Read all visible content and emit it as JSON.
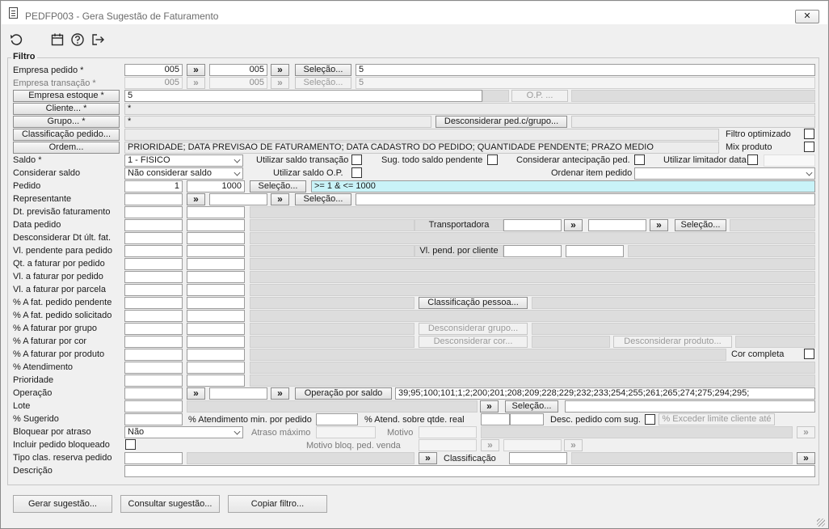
{
  "window": {
    "title": "PEDFP003 - Gera Sugestão de Faturamento",
    "close_glyph": "✕"
  },
  "toolbar": {
    "icons": [
      "refresh-icon",
      "calendar-icon",
      "help-icon",
      "exit-icon"
    ]
  },
  "group_title": "Filtro",
  "labels": {
    "empresa_pedido": "Empresa pedido *",
    "empresa_transacao": "Empresa transação *",
    "saldo": "Saldo *",
    "considerar_saldo": "Considerar saldo",
    "pedido": "Pedido",
    "representante": "Representante",
    "dt_previsao": "Dt. previsão faturamento",
    "data_pedido": "Data pedido",
    "desconsiderar_dt": "Desconsiderar Dt últ. fat.",
    "vl_pendente": "Vl. pendente para pedido",
    "qt_faturar_pedido": "Qt. a faturar por pedido",
    "vl_faturar_pedido": "Vl. a faturar por pedido",
    "vl_faturar_parcela": "Vl. a faturar por parcela",
    "pct_fat_pendente": "% A fat. pedido pendente",
    "pct_fat_solicitado": "% A fat. pedido solicitado",
    "pct_faturar_grupo": "% A faturar por grupo",
    "pct_faturar_cor": "% A faturar por cor",
    "pct_faturar_produto": "% A faturar por produto",
    "pct_atendimento": "% Atendimento",
    "prioridade": "Prioridade",
    "operacao": "Operação",
    "lote": "Lote",
    "pct_sugerido": "% Sugerido",
    "bloquear_atraso": "Bloquear por atraso",
    "incluir_bloqueado": "Incluir pedido bloqueado",
    "tipo_clas_reserva": "Tipo clas. reserva pedido",
    "descricao": "Descrição",
    "filtro_optimizado": "Filtro optimizado",
    "mix_produto": "Mix produto",
    "utilizar_saldo_transacao": "Utilizar saldo transação",
    "sug_todo_saldo": "Sug. todo saldo pendente",
    "considerar_antecipacao": "Considerar antecipação ped.",
    "utilizar_limitador": "Utilizar limitador data",
    "utilizar_saldo_op": "Utilizar saldo O.P.",
    "ordenar_item": "Ordenar item pedido",
    "transportadora": "Transportadora",
    "vl_pend_cliente": "Vl. pend. por cliente",
    "cor_completa": "Cor completa",
    "pct_atend_min": "% Atendimento min. por pedido",
    "pct_atend_qtde": "% Atend. sobre qtde. real",
    "desc_pedido_sug": "Desc. pedido com sug.",
    "atraso_maximo": "Atraso máximo",
    "motivo": "Motivo",
    "motivo_bloq": "Motivo bloq. ped. venda",
    "classificacao": "Classificação"
  },
  "buttons": {
    "selecao": "Seleção...",
    "arrow": "»",
    "empresa_estoque": "Empresa estoque *",
    "op": "O.P. ...",
    "cliente": "Cliente... *",
    "grupo": "Grupo... *",
    "desconsiderar_ped_grupo": "Desconsiderar ped.c/grupo...",
    "classificacao_pedido": "Classificação pedido...",
    "ordem": "Ordem...",
    "classificacao_pessoa": "Classificação pessoa...",
    "desconsiderar_grupo": "Desconsiderar grupo...",
    "desconsiderar_cor": "Desconsiderar cor...",
    "desconsiderar_produto": "Desconsiderar produto...",
    "operacao_saldo": "Operação por saldo",
    "pct_exceder": "% Exceder limite cliente até",
    "gerar": "Gerar sugestão...",
    "consultar": "Consultar sugestão...",
    "copiar": "Copiar filtro..."
  },
  "values": {
    "empresa_pedido_de": "005",
    "empresa_pedido_ate": "005",
    "empresa_pedido_sel": "5",
    "empresa_transacao_de": "005",
    "empresa_transacao_ate": "005",
    "empresa_transacao_sel": "5",
    "empresa_estoque": "5",
    "cliente": "*",
    "grupo": "*",
    "ordem": "PRIORIDADE; DATA PREVISAO DE FATURAMENTO; DATA CADASTRO DO PEDIDO; QUANTIDADE PENDENTE; PRAZO MEDIO",
    "saldo": "1 - FISICO",
    "considerar_saldo": "Não considerar saldo",
    "pedido_de": "1",
    "pedido_ate": "1000",
    "pedido_sel": ">= 1  &  <= 1000",
    "operacao_list": "39;95;100;101;1;2;200;201;208;209;228;229;232;233;254;255;261;265;274;275;294;295;",
    "bloquear_atraso": "Não"
  },
  "colors": {
    "accent_cyan": "#c9f3f8"
  }
}
